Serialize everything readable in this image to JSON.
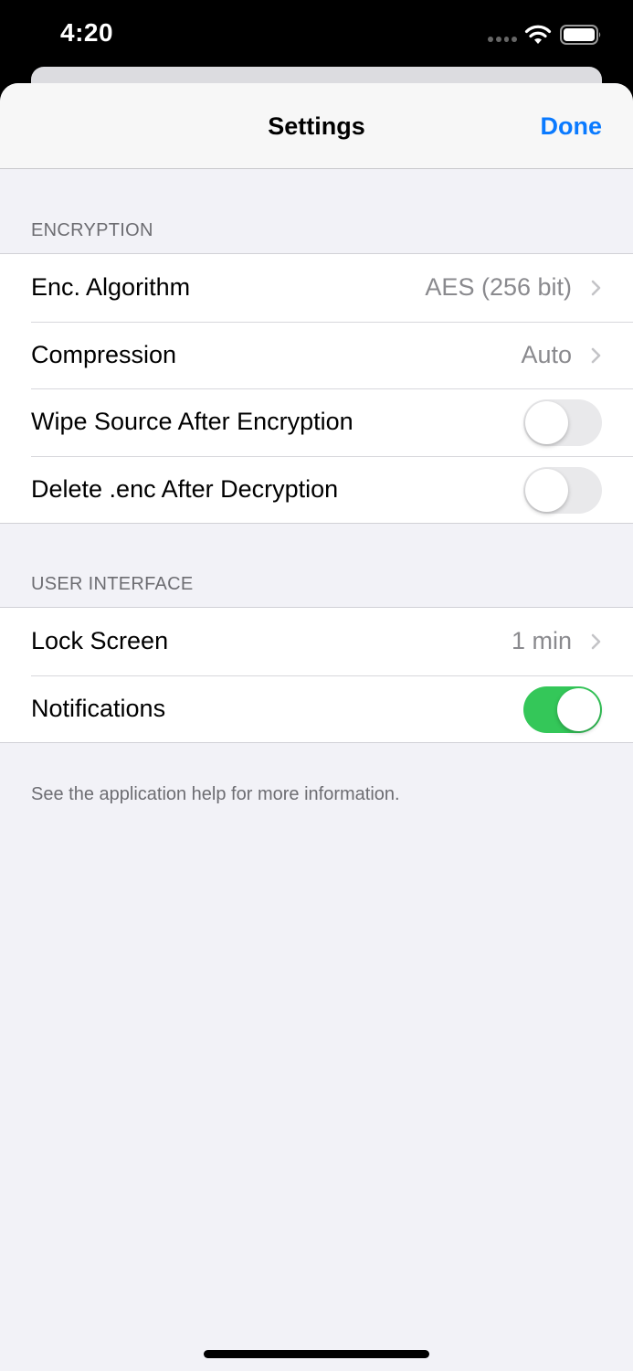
{
  "status_bar": {
    "time": "4:20",
    "icons": [
      "signal-icon",
      "wifi-icon",
      "battery-icon"
    ]
  },
  "nav": {
    "title": "Settings",
    "done_label": "Done"
  },
  "sections": {
    "encryption": {
      "header": "ENCRYPTION",
      "rows": [
        {
          "label": "Enc. Algorithm",
          "value": "AES (256 bit)",
          "type": "disclosure"
        },
        {
          "label": "Compression",
          "value": "Auto",
          "type": "disclosure"
        },
        {
          "label": "Wipe Source After Encryption",
          "type": "toggle",
          "on": false
        },
        {
          "label": "Delete .enc After Decryption",
          "type": "toggle",
          "on": false
        }
      ]
    },
    "user_interface": {
      "header": "USER INTERFACE",
      "rows": [
        {
          "label": "Lock Screen",
          "value": "1 min",
          "type": "disclosure"
        },
        {
          "label": "Notifications",
          "type": "toggle",
          "on": true
        }
      ]
    }
  },
  "footer": "See the application help for more information.",
  "colors": {
    "accent": "#0a7aff",
    "toggle_on": "#34c759",
    "toggle_off": "#e9e9eb",
    "background": "#f2f2f7"
  }
}
